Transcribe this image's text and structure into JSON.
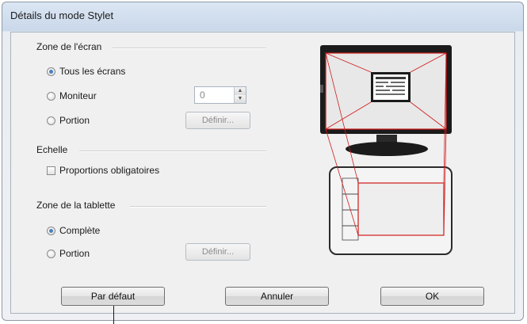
{
  "window": {
    "title": "Détails du mode Stylet"
  },
  "screen_area": {
    "label": "Zone de l'écran",
    "options": [
      {
        "label": "Tous les écrans",
        "selected": true
      },
      {
        "label": "Moniteur",
        "selected": false
      },
      {
        "label": "Portion",
        "selected": false
      }
    ],
    "monitor_value": "0",
    "define_label": "Définir..."
  },
  "scale": {
    "label": "Echelle",
    "force_proportions_label": "Proportions obligatoires",
    "force_proportions_checked": false
  },
  "tablet_area": {
    "label": "Zone de la tablette",
    "options": [
      {
        "label": "Complète",
        "selected": true
      },
      {
        "label": "Portion",
        "selected": false
      }
    ],
    "define_label": "Définir..."
  },
  "buttons": {
    "default_label": "Par défaut",
    "cancel_label": "Annuler",
    "ok_label": "OK"
  },
  "colors": {
    "mapping_lines": "#d11a1a",
    "radio_selected": "#4a7fc1"
  }
}
